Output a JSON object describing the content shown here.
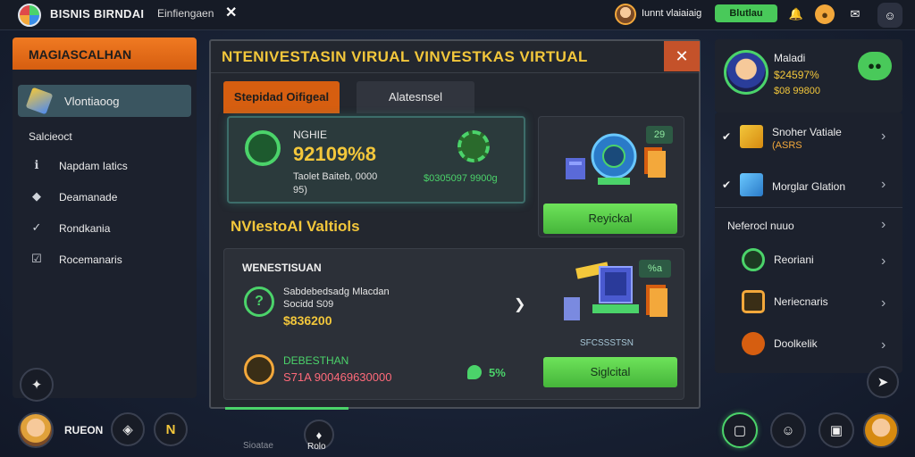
{
  "topbar": {
    "app_title": "BISNIS BIRNDAI",
    "tab_name": "Einfiengaen",
    "tab_close": "✕",
    "user_text": "Iunnt vlaiaiaig",
    "balance": "Blutlau",
    "icons": [
      "bell-icon",
      "coin-icon",
      "chat-bubble-icon",
      "discord-icon"
    ]
  },
  "sidebar": {
    "header": "MAGIASCALHAN",
    "active_item": "Vlontiaoog",
    "section": "Salcieoct",
    "items": [
      {
        "label": "Napdam Iatics",
        "icon": "info-icon"
      },
      {
        "label": "Deamanade",
        "icon": "shield-icon"
      },
      {
        "label": "Rondkania",
        "icon": "check-icon"
      },
      {
        "label": "Rocemanaris",
        "icon": "checkbox-icon"
      }
    ],
    "bottom_label": "RUEON",
    "bottom_n": "N"
  },
  "panel": {
    "title": "NTENIVESTASIN VIRUAL VINVESTKAS VIRTUAL",
    "close": "✕",
    "tabs": [
      {
        "label": "Stepidad Oifigeal"
      },
      {
        "label": "Alatesnsel"
      }
    ],
    "main_card": {
      "label": "NGHIE",
      "value": "92109%8",
      "desc_line1": "Taolet Baiteb, 0000",
      "desc_line2": "95)",
      "amount": "$0305097 9900g"
    },
    "side_card_1": {
      "badge": "29",
      "button": "Reyickal"
    },
    "section_title": "NVIestoAI Valtiols",
    "bottom_card": {
      "title": "WENESTISUAN",
      "line1": "Sabdebedsadg Mlacdan",
      "line2": "Socidd S09",
      "value1": "$836200",
      "label2": "DEBESTHAN",
      "value2": "S71A 900469630000",
      "percent": "5%",
      "badge": "%a",
      "caption": "SFCSSSTSN",
      "button": "Siglcital"
    }
  },
  "bottom_center": {
    "left_label": "Sioatae",
    "label": "Rolo"
  },
  "profile": {
    "name": "Maladi",
    "line1": "$24597%",
    "line2": "$08 99800"
  },
  "right_list": {
    "items": [
      {
        "label": "Snoher Vatiale",
        "sub": "(ASRS"
      },
      {
        "label": "Morglar Glation",
        "sub": ""
      }
    ],
    "section": "Neferocl nuuo",
    "sub_items": [
      {
        "label": "Reoriani",
        "icon": "coin-icon"
      },
      {
        "label": "Neriecnaris",
        "icon": "square-badge-icon"
      },
      {
        "label": "Doolkelik",
        "icon": "fox-icon"
      }
    ]
  },
  "colors": {
    "accent_orange": "#d65e10",
    "accent_gold": "#f3c73b",
    "accent_green": "#4bd36a",
    "panel_bg": "#23272f"
  }
}
